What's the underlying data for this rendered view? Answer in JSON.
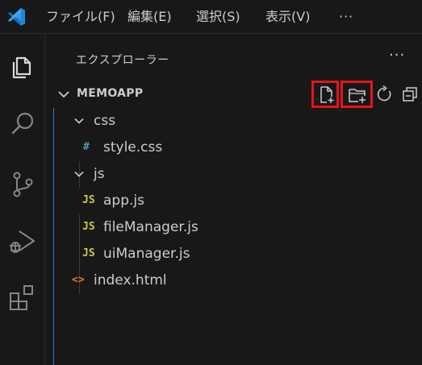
{
  "menu": {
    "items": [
      "ファイル(F)",
      "編集(E)",
      "選択(S)",
      "表示(V)"
    ],
    "overflow": "···"
  },
  "activity": {
    "icons": [
      "explorer-icon",
      "search-icon",
      "source-control-icon",
      "run-debug-icon",
      "extensions-icon"
    ]
  },
  "sidebar": {
    "title": "エクスプローラー",
    "more": "···",
    "section": {
      "name": "MEMOAPP",
      "actions": [
        "new-file",
        "new-folder",
        "refresh",
        "collapse-all"
      ]
    },
    "tree": [
      {
        "label": "css",
        "type": "folder",
        "expanded": true
      },
      {
        "label": "style.css",
        "type": "file",
        "icon_text": "#",
        "icon_color": "#519aba"
      },
      {
        "label": "js",
        "type": "folder",
        "expanded": true
      },
      {
        "label": "app.js",
        "type": "file",
        "icon_text": "JS",
        "icon_color": "#cbcb41"
      },
      {
        "label": "fileManager.js",
        "type": "file",
        "icon_text": "JS",
        "icon_color": "#cbcb41"
      },
      {
        "label": "uiManager.js",
        "type": "file",
        "icon_text": "JS",
        "icon_color": "#cbcb41"
      },
      {
        "label": "index.html",
        "type": "file",
        "icon_text": "<>",
        "icon_color": "#e37933"
      }
    ]
  },
  "colors": {
    "background": "#181818",
    "accent": "#0078d4",
    "highlight": "#e8131a"
  }
}
